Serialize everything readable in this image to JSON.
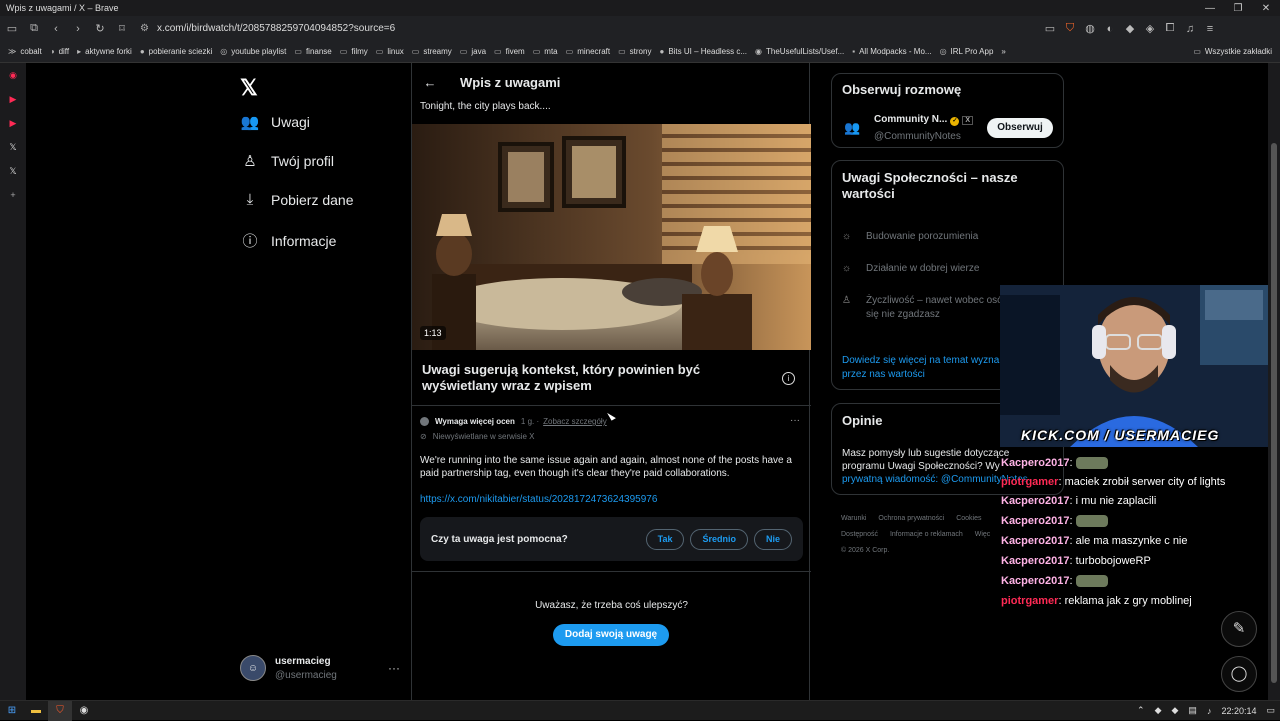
{
  "window": {
    "title": "Wpis z uwagami / X – Brave"
  },
  "browser": {
    "url": "x.com/i/birdwatch/t/2085788259704094852?source=6",
    "bookmarks": [
      "cobalt",
      "diff",
      "aktywne forki",
      "pobieranie sciezki",
      "youtube playlist",
      "finanse",
      "filmy",
      "linux",
      "streamy",
      "java",
      "fivem",
      "mta",
      "minecraft",
      "strony",
      "Bits UI – Headless c...",
      "TheUsefulLists/Usef...",
      "All Modpacks - Mo...",
      "IRL Pro App"
    ],
    "bookmarks_more": "»",
    "all_bookmarks": "Wszystkie zakładki"
  },
  "nav": {
    "items": [
      {
        "label": "Uwagi",
        "icon": "people-icon"
      },
      {
        "label": "Twój profil",
        "icon": "person-icon"
      },
      {
        "label": "Pobierz dane",
        "icon": "download-icon"
      },
      {
        "label": "Informacje",
        "icon": "info-icon"
      }
    ],
    "account": {
      "name": "usermacieg",
      "handle": "@usermacieg",
      "more": "···"
    }
  },
  "center": {
    "header_title": "Wpis z uwagami",
    "post_text": "Tonight, the city plays back....",
    "video_duration": "1:13",
    "context_title": "Uwagi sugerują kontekst, który powinien być wyświetlany wraz z wpisem",
    "note": {
      "status": "Wymaga więcej ocen",
      "time": "1 g.",
      "details_link": "Zobacz szczegóły",
      "hidden": "Niewyświetlane w serwisie X",
      "body": "We're running into the same issue again and again, almost none of the posts have a paid partnership tag, even though it's clear they're paid collaborations.",
      "link": "https://x.com/nikitabier/status/2028172473624395976",
      "more": "···"
    },
    "helpful": {
      "question": "Czy ta uwaga jest pomocna?",
      "yes": "Tak",
      "medium": "Średnio",
      "no": "Nie"
    },
    "improve_text": "Uważasz, że trzeba coś ulepszyć?",
    "add_note": "Dodaj swoją uwagę"
  },
  "right": {
    "follow": {
      "title": "Obserwuj rozmowę",
      "account_name": "Community N...",
      "account_handle": "@CommunityNotes",
      "follow_label": "Obserwuj"
    },
    "values": {
      "title": "Uwagi Społeczności – nasze wartości",
      "items": [
        "Budowanie porozumienia",
        "Działanie w dobrej wierze",
        "Życzliwość – nawet wobec osó",
        "się nie zgadzasz"
      ],
      "more": "Dowiedz się więcej na temat wyzna",
      "more2": "przez nas wartości"
    },
    "opinions": {
      "title": "Opinie",
      "text": "Masz pomysły lub sugestie dotyczące",
      "text2": "programu Uwagi Społeczności? Wy",
      "text3": "prywatną wiadomość: @CommunityNotes"
    },
    "footer": {
      "row1": [
        "Warunki",
        "Ochrona prywatności",
        "Cookies"
      ],
      "row2": [
        "Dostępność",
        "Informacje o reklamach",
        "Więc"
      ],
      "copyright": "© 2026 X Corp."
    }
  },
  "overlay": {
    "watermark": "KICK.COM / USERMACIEG",
    "chat": [
      {
        "user": "Kacpero2017",
        "color": "#ffb3e6",
        "text": "",
        "emote": true
      },
      {
        "user": "piotrgamer",
        "color": "#ff2a55",
        "text": " maciek zrobił serwer city of lights",
        "emote": false
      },
      {
        "user": "Kacpero2017",
        "color": "#ffb3e6",
        "text": " i mu nie zaplacili",
        "emote": false
      },
      {
        "user": "Kacpero2017",
        "color": "#ffb3e6",
        "text": "",
        "emote": true
      },
      {
        "user": "Kacpero2017",
        "color": "#ffb3e6",
        "text": " ale ma maszynke c nie",
        "emote": false
      },
      {
        "user": "Kacpero2017",
        "color": "#ffb3e6",
        "text": " turbobojoweRP",
        "emote": false
      },
      {
        "user": "Kacpero2017",
        "color": "#ffb3e6",
        "text": "",
        "emote": true
      },
      {
        "user": "piotrgamer",
        "color": "#ff2a55",
        "text": " reklama jak z gry moblinej",
        "emote": false
      }
    ]
  },
  "taskbar": {
    "time": "22:20:14"
  }
}
